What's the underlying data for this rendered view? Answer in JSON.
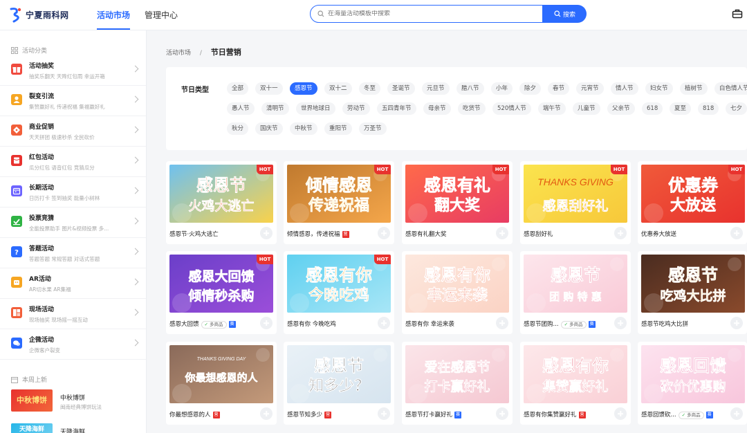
{
  "brand": {
    "name": "宁夏雨科网"
  },
  "nav": {
    "tabs": [
      {
        "label": "活动市场"
      },
      {
        "label": "管理中心"
      }
    ]
  },
  "search": {
    "placeholder": "在海量活动模板中搜索",
    "button": "搜索"
  },
  "sidebar": {
    "section_title": "活动分类",
    "categories": [
      {
        "title": "活动抽奖",
        "sub": "抽奖乐翻天   天降红包雨   幸运开箱",
        "icon": "gift-icon",
        "color": "#f04a3e"
      },
      {
        "title": "裂变引流",
        "sub": "集赞赢好礼   传递祝福   集福赢好礼",
        "icon": "user-icon",
        "color": "#f6a623"
      },
      {
        "title": "商业促销",
        "sub": "天天拼团   极速秒杀   全民砍价",
        "icon": "tag-icon",
        "color": "#f25f3a"
      },
      {
        "title": "红包活动",
        "sub": "瓜分红包   语音红包   竞猜瓜分",
        "icon": "red-packet-icon",
        "color": "#e8322e"
      },
      {
        "title": "长期活动",
        "sub": "日历打卡   签到抽奖   能量小树林",
        "icon": "calendar-icon",
        "color": "#6c63ff"
      },
      {
        "title": "投票竞猜",
        "sub": "全能投票助手   图片&视频投票   多...",
        "icon": "vote-icon",
        "color": "#2fb344"
      },
      {
        "title": "答题活动",
        "sub": "答题答题   常规答题   对话式答题",
        "icon": "question-icon",
        "color": "#2b6bff"
      },
      {
        "title": "AR活动",
        "sub": "AR切水果   AR集福",
        "icon": "robot-icon",
        "color": "#f6a623"
      },
      {
        "title": "现场活动",
        "sub": "现场抽奖   现场摇一摇互动",
        "icon": "grid-icon",
        "color": "#f25f3a"
      },
      {
        "title": "企微活动",
        "sub": "企微客户裂变",
        "icon": "chat-icon",
        "color": "#2b6bff"
      }
    ],
    "week_title": "本周上新",
    "week_items": [
      {
        "title": "中秋博饼",
        "sub": "闽南经典博饼玩法",
        "thumb_text": "中秋博饼"
      },
      {
        "title": "天降海鲜",
        "sub": "",
        "thumb_text": "天降海鲜"
      }
    ]
  },
  "breadcrumb": {
    "root": "活动市场",
    "sep": "/",
    "current": "节日营销"
  },
  "filter": {
    "label": "节日类型",
    "rows": [
      [
        "全部",
        "双十一",
        "感恩节",
        "双十二",
        "冬至",
        "圣诞节",
        "元旦节",
        "腊八节",
        "小年",
        "除夕",
        "春节",
        "元宵节",
        "情人节",
        "妇女节",
        "植树节",
        "白色情人节"
      ],
      [
        "愚人节",
        "清明节",
        "世界地球日",
        "劳动节",
        "五四青年节",
        "母亲节",
        "吃货节",
        "520情人节",
        "端午节",
        "儿童节",
        "父亲节",
        "618",
        "夏至",
        "818",
        "七夕"
      ],
      [
        "秋分",
        "国庆节",
        "中秋节",
        "重阳节",
        "万圣节"
      ]
    ],
    "active": "感恩节"
  },
  "hot_label": "HOT",
  "tags": {
    "ying": "营",
    "zhuan": "赛",
    "multi": "多商品"
  },
  "cards": [
    {
      "title": "感恩节·火鸡大逃亡",
      "hot": true,
      "tags": [],
      "art": [
        "感恩节",
        "火鸡大逃亡"
      ],
      "bg": [
        "#6fc1ef",
        "#f9d24b"
      ],
      "fg": "#f25c1f"
    },
    {
      "title": "倾情感恩，传递祝福",
      "hot": true,
      "tags": [
        "ying"
      ],
      "art": [
        "倾情感恩",
        "传递祝福"
      ],
      "bg": [
        "#c07a2f",
        "#f4a64a"
      ],
      "fg": "#ffdf56"
    },
    {
      "title": "感恩有礼翻大奖",
      "hot": true,
      "tags": [],
      "art": [
        "感恩有礼",
        "翻大奖"
      ],
      "bg": [
        "#ff6a4a",
        "#e83c63"
      ],
      "fg": "#ffffff"
    },
    {
      "title": "感恩刮好礼",
      "hot": true,
      "tags": [],
      "art": [
        "THANKS GIVING",
        "感恩刮好礼"
      ],
      "bg": [
        "#fbe44e",
        "#f7c83a"
      ],
      "fg": "#e35a12"
    },
    {
      "title": "优惠券大放送",
      "hot": true,
      "tags": [],
      "art": [
        "优惠券",
        "大放送"
      ],
      "bg": [
        "#f05a3a",
        "#e8322e"
      ],
      "fg": "#ffffff"
    },
    {
      "title": "感恩大回馈",
      "hot": true,
      "tags": [
        "multi",
        "zhuan"
      ],
      "art": [
        "感恩大回馈",
        "倾情秒杀购"
      ],
      "bg": [
        "#6b3fc9",
        "#9b4ed9"
      ],
      "fg": "#ffffff"
    },
    {
      "title": "感恩有你 今晚吃鸡",
      "hot": true,
      "tags": [],
      "art": [
        "感恩有你",
        "今晚吃鸡"
      ],
      "bg": [
        "#5fd0f0",
        "#a8e6f6"
      ],
      "fg": "#f7a21f"
    },
    {
      "title": "感恩有你 幸运来袭",
      "hot": false,
      "tags": [],
      "art": [
        "感恩有你",
        "幸运来袭"
      ],
      "bg": [
        "#fde8de",
        "#fbd3c4"
      ],
      "fg": "#f0553a"
    },
    {
      "title": "感恩节团购...",
      "hot": false,
      "tags": [
        "multi",
        "zhuan"
      ],
      "art": [
        "感恩节",
        "团 购 特 惠"
      ],
      "bg": [
        "#fde6ec",
        "#f9cad7"
      ],
      "fg": "#e0476f"
    },
    {
      "title": "感恩节吃鸡大比拼",
      "hot": false,
      "tags": [],
      "art": [
        "感恩节",
        "吃鸡大比拼"
      ],
      "bg": [
        "#4a2c20",
        "#8a4a2c"
      ],
      "fg": "#f6c55a"
    },
    {
      "title": "你最想感恩的人",
      "hot": false,
      "tags": [
        "ying"
      ],
      "art": [
        "THANKS GIVING DAY",
        "你最想感恩的人"
      ],
      "bg": [
        "#8a6a5a",
        "#c49a7a"
      ],
      "fg": "#ffffff"
    },
    {
      "title": "感恩节知多少",
      "hot": false,
      "tags": [
        "ying"
      ],
      "art": [
        "感恩节",
        "知多少？"
      ],
      "bg": [
        "#e9f1f7",
        "#d6e4ef"
      ],
      "fg": "#2a2a2a"
    },
    {
      "title": "感恩节打卡赢好礼",
      "hot": false,
      "tags": [
        "zhuan"
      ],
      "art": [
        "爱在感恩节",
        "打卡赢好礼"
      ],
      "bg": [
        "#fbe5e9",
        "#f5c8d2"
      ],
      "fg": "#e63c6a"
    },
    {
      "title": "感恩有你集赞赢好礼",
      "hot": false,
      "tags": [
        "ying"
      ],
      "art": [
        "感恩有你",
        "集赞赢好礼"
      ],
      "bg": [
        "#fde8ea",
        "#fad0d6"
      ],
      "fg": "#e0334b"
    },
    {
      "title": "感恩回馈砍...",
      "hot": false,
      "tags": [
        "multi",
        "zhuan"
      ],
      "art": [
        "感恩回馈",
        "砍价优惠购"
      ],
      "bg": [
        "#fde3ef",
        "#f8c6dc"
      ],
      "fg": "#e84a8a"
    }
  ]
}
